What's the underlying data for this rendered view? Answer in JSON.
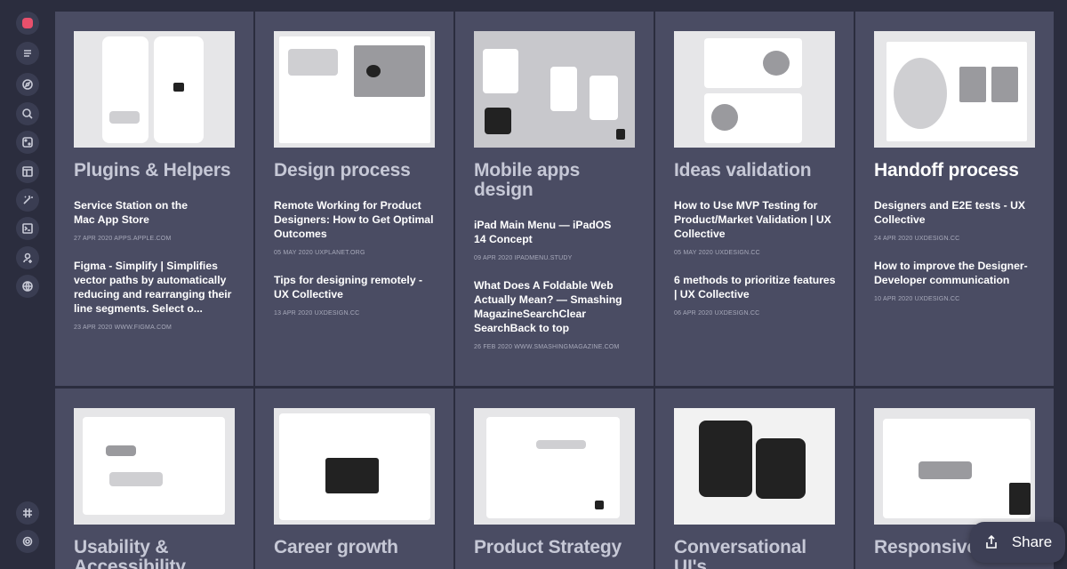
{
  "sidebar": {
    "icons": [
      "app-logo-icon",
      "list-icon",
      "compass-icon",
      "search-icon",
      "layout-icon",
      "panel-icon",
      "magic-icon",
      "terminal-icon",
      "user-add-icon",
      "globe-icon",
      "slack-icon",
      "settings-icon"
    ]
  },
  "columns": [
    {
      "title": "Plugins & Helpers",
      "links": [
        {
          "title": "Service Station on the Mac App Store",
          "meta": "27 APR 2020 APPS.APPLE.COM"
        },
        {
          "title": "Figma - Simplify | Simplifies vector paths by automatically reducing and rearranging their line segments. Select o...",
          "meta": "23 APR 2020 WWW.FIGMA.COM"
        }
      ]
    },
    {
      "title": "Design process",
      "links": [
        {
          "title": "Remote Working for Product Designers: How to Get Optimal Outcomes",
          "meta": "05 MAY 2020 UXPLANET.ORG"
        },
        {
          "title": "Tips for designing remotely - UX Collective",
          "meta": "13 APR 2020 UXDESIGN.CC"
        }
      ]
    },
    {
      "title": "Mobile apps design",
      "links": [
        {
          "title": "iPad Main Menu — iPadOS 14 Concept",
          "meta": "09 APR 2020 IPADMENU.STUDY"
        },
        {
          "title": "What Does A Foldable Web Actually Mean? — Smashing MagazineSearchClear SearchBack to top",
          "meta": "26 FEB 2020 WWW.SMASHINGMAGAZINE.COM"
        }
      ]
    },
    {
      "title": "Ideas validation",
      "links": [
        {
          "title": "How to Use MVP Testing for Product/Market Validation | UX Collective",
          "meta": "05 MAY 2020 UXDESIGN.CC"
        },
        {
          "title": "6 methods to prioritize features | UX Collective",
          "meta": "06 APR 2020 UXDESIGN.CC"
        }
      ]
    },
    {
      "title": "Handoff process",
      "links": [
        {
          "title": "Designers and E2E tests - UX Collective",
          "meta": "24 APR 2020 UXDESIGN.CC"
        },
        {
          "title": "How to improve the Designer-Developer communication",
          "meta": "10 APR 2020 UXDESIGN.CC"
        }
      ]
    }
  ],
  "bottom_titles": [
    "Usability & Accessibility",
    "Career growth",
    "Product Strategy",
    "Conversational UI's",
    "Responsive"
  ],
  "share": {
    "label": "Share"
  },
  "colors": {
    "background": "#2b2d3e",
    "card": "#4a4c63",
    "accent": "#e8506c"
  }
}
